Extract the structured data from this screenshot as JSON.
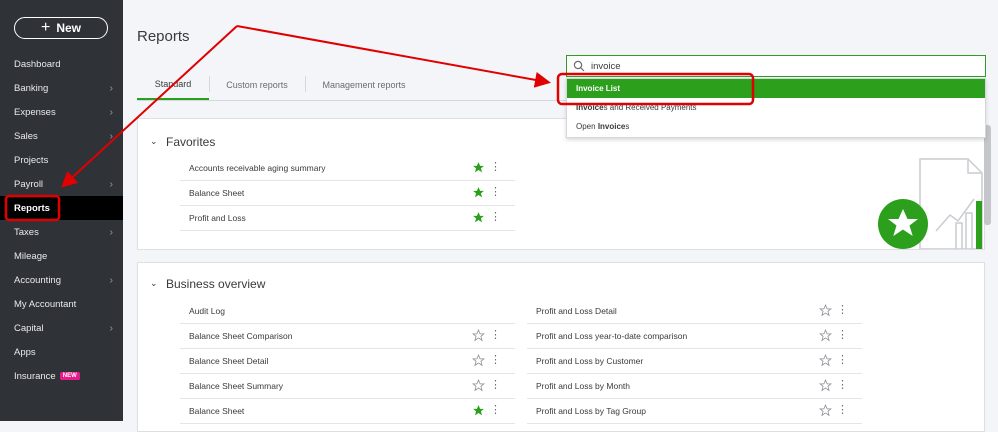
{
  "sidebar": {
    "new_label": "New",
    "items": [
      {
        "label": "Dashboard"
      },
      {
        "label": "Banking"
      },
      {
        "label": "Expenses"
      },
      {
        "label": "Sales"
      },
      {
        "label": "Projects"
      },
      {
        "label": "Payroll"
      },
      {
        "label": "Reports"
      },
      {
        "label": "Taxes"
      },
      {
        "label": "Mileage"
      },
      {
        "label": "Accounting"
      },
      {
        "label": "My Accountant"
      },
      {
        "label": "Capital"
      },
      {
        "label": "Apps"
      },
      {
        "label": "Insurance"
      }
    ],
    "insurance_badge": "NEW"
  },
  "page": {
    "title": "Reports"
  },
  "tabs": [
    {
      "label": "Standard"
    },
    {
      "label": "Custom reports"
    },
    {
      "label": "Management reports"
    }
  ],
  "search": {
    "value": "invoice",
    "results": [
      {
        "text": "Invoice List"
      },
      {
        "bold": "Invoice",
        "rest": "s and Received Payments"
      },
      {
        "pre": "Open ",
        "bold": "Invoice",
        "rest": "s"
      }
    ]
  },
  "favorites": {
    "title": "Favorites",
    "rows": [
      {
        "label": "Accounts receivable aging summary"
      },
      {
        "label": "Balance Sheet"
      },
      {
        "label": "Profit and Loss"
      }
    ]
  },
  "business_overview": {
    "title": "Business overview",
    "left_rows": [
      {
        "label": "Audit Log"
      },
      {
        "label": "Balance Sheet Comparison"
      },
      {
        "label": "Balance Sheet Detail"
      },
      {
        "label": "Balance Sheet Summary"
      },
      {
        "label": "Balance Sheet"
      }
    ],
    "right_rows": [
      {
        "label": "Profit and Loss Detail"
      },
      {
        "label": "Profit and Loss year-to-date comparison"
      },
      {
        "label": "Profit and Loss by Customer"
      },
      {
        "label": "Profit and Loss by Month"
      },
      {
        "label": "Profit and Loss by Tag Group"
      }
    ]
  },
  "colors": {
    "accent_green": "#2ca01c",
    "sidebar_bg": "#2f3237",
    "annotation_red": "#e00000",
    "badge_pink": "#e81b8b"
  }
}
